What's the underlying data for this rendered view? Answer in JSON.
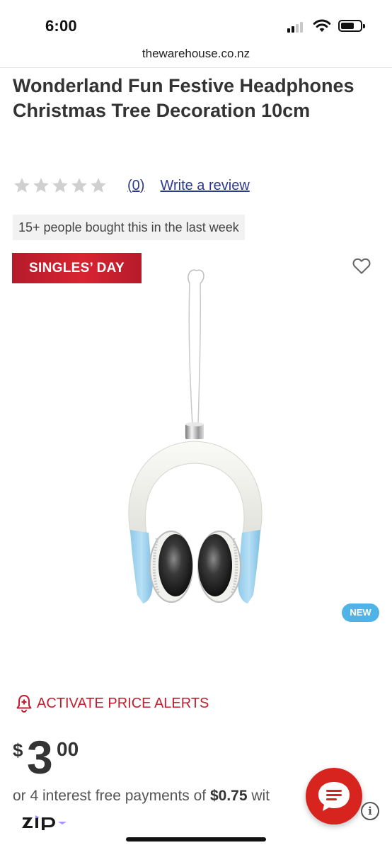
{
  "status_bar": {
    "time": "6:00",
    "signal_icon": "cellular-signal-icon",
    "wifi_icon": "wifi-icon",
    "battery_icon": "battery-icon"
  },
  "browser": {
    "url": "thewarehouse.co.nz"
  },
  "product": {
    "title": "Wonderland Fun Festive Headphones Christmas Tree Decoration 10cm",
    "rating": {
      "stars_filled": 0,
      "stars_total": 5,
      "review_count": "(0)",
      "write_review": "Write a review"
    },
    "social_proof": "15+ people bought this in the last week",
    "promo_badge": "SINGLES’ DAY",
    "new_badge": "NEW",
    "price_alert": "ACTIVATE PRICE ALERTS",
    "price": {
      "currency": "$",
      "dollars": "3",
      "cents": "00"
    },
    "installments": {
      "prefix": "or 4 interest free payments of ",
      "amount": "$0.75",
      "suffix": " wit"
    },
    "payment_provider_logo": "ZIP"
  },
  "icons": {
    "star": "star-icon",
    "wishlist": "heart-icon",
    "price_alert": "bell-alert-icon",
    "chat": "chat-bubble-icon",
    "info": "info-icon"
  },
  "colors": {
    "brand_red": "#c41e2e",
    "link_blue": "#2b3a8c",
    "new_badge_blue": "#4fb3e8",
    "chat_red": "#d7241f",
    "star_grey": "#d0d0d0"
  },
  "info_label": "i"
}
